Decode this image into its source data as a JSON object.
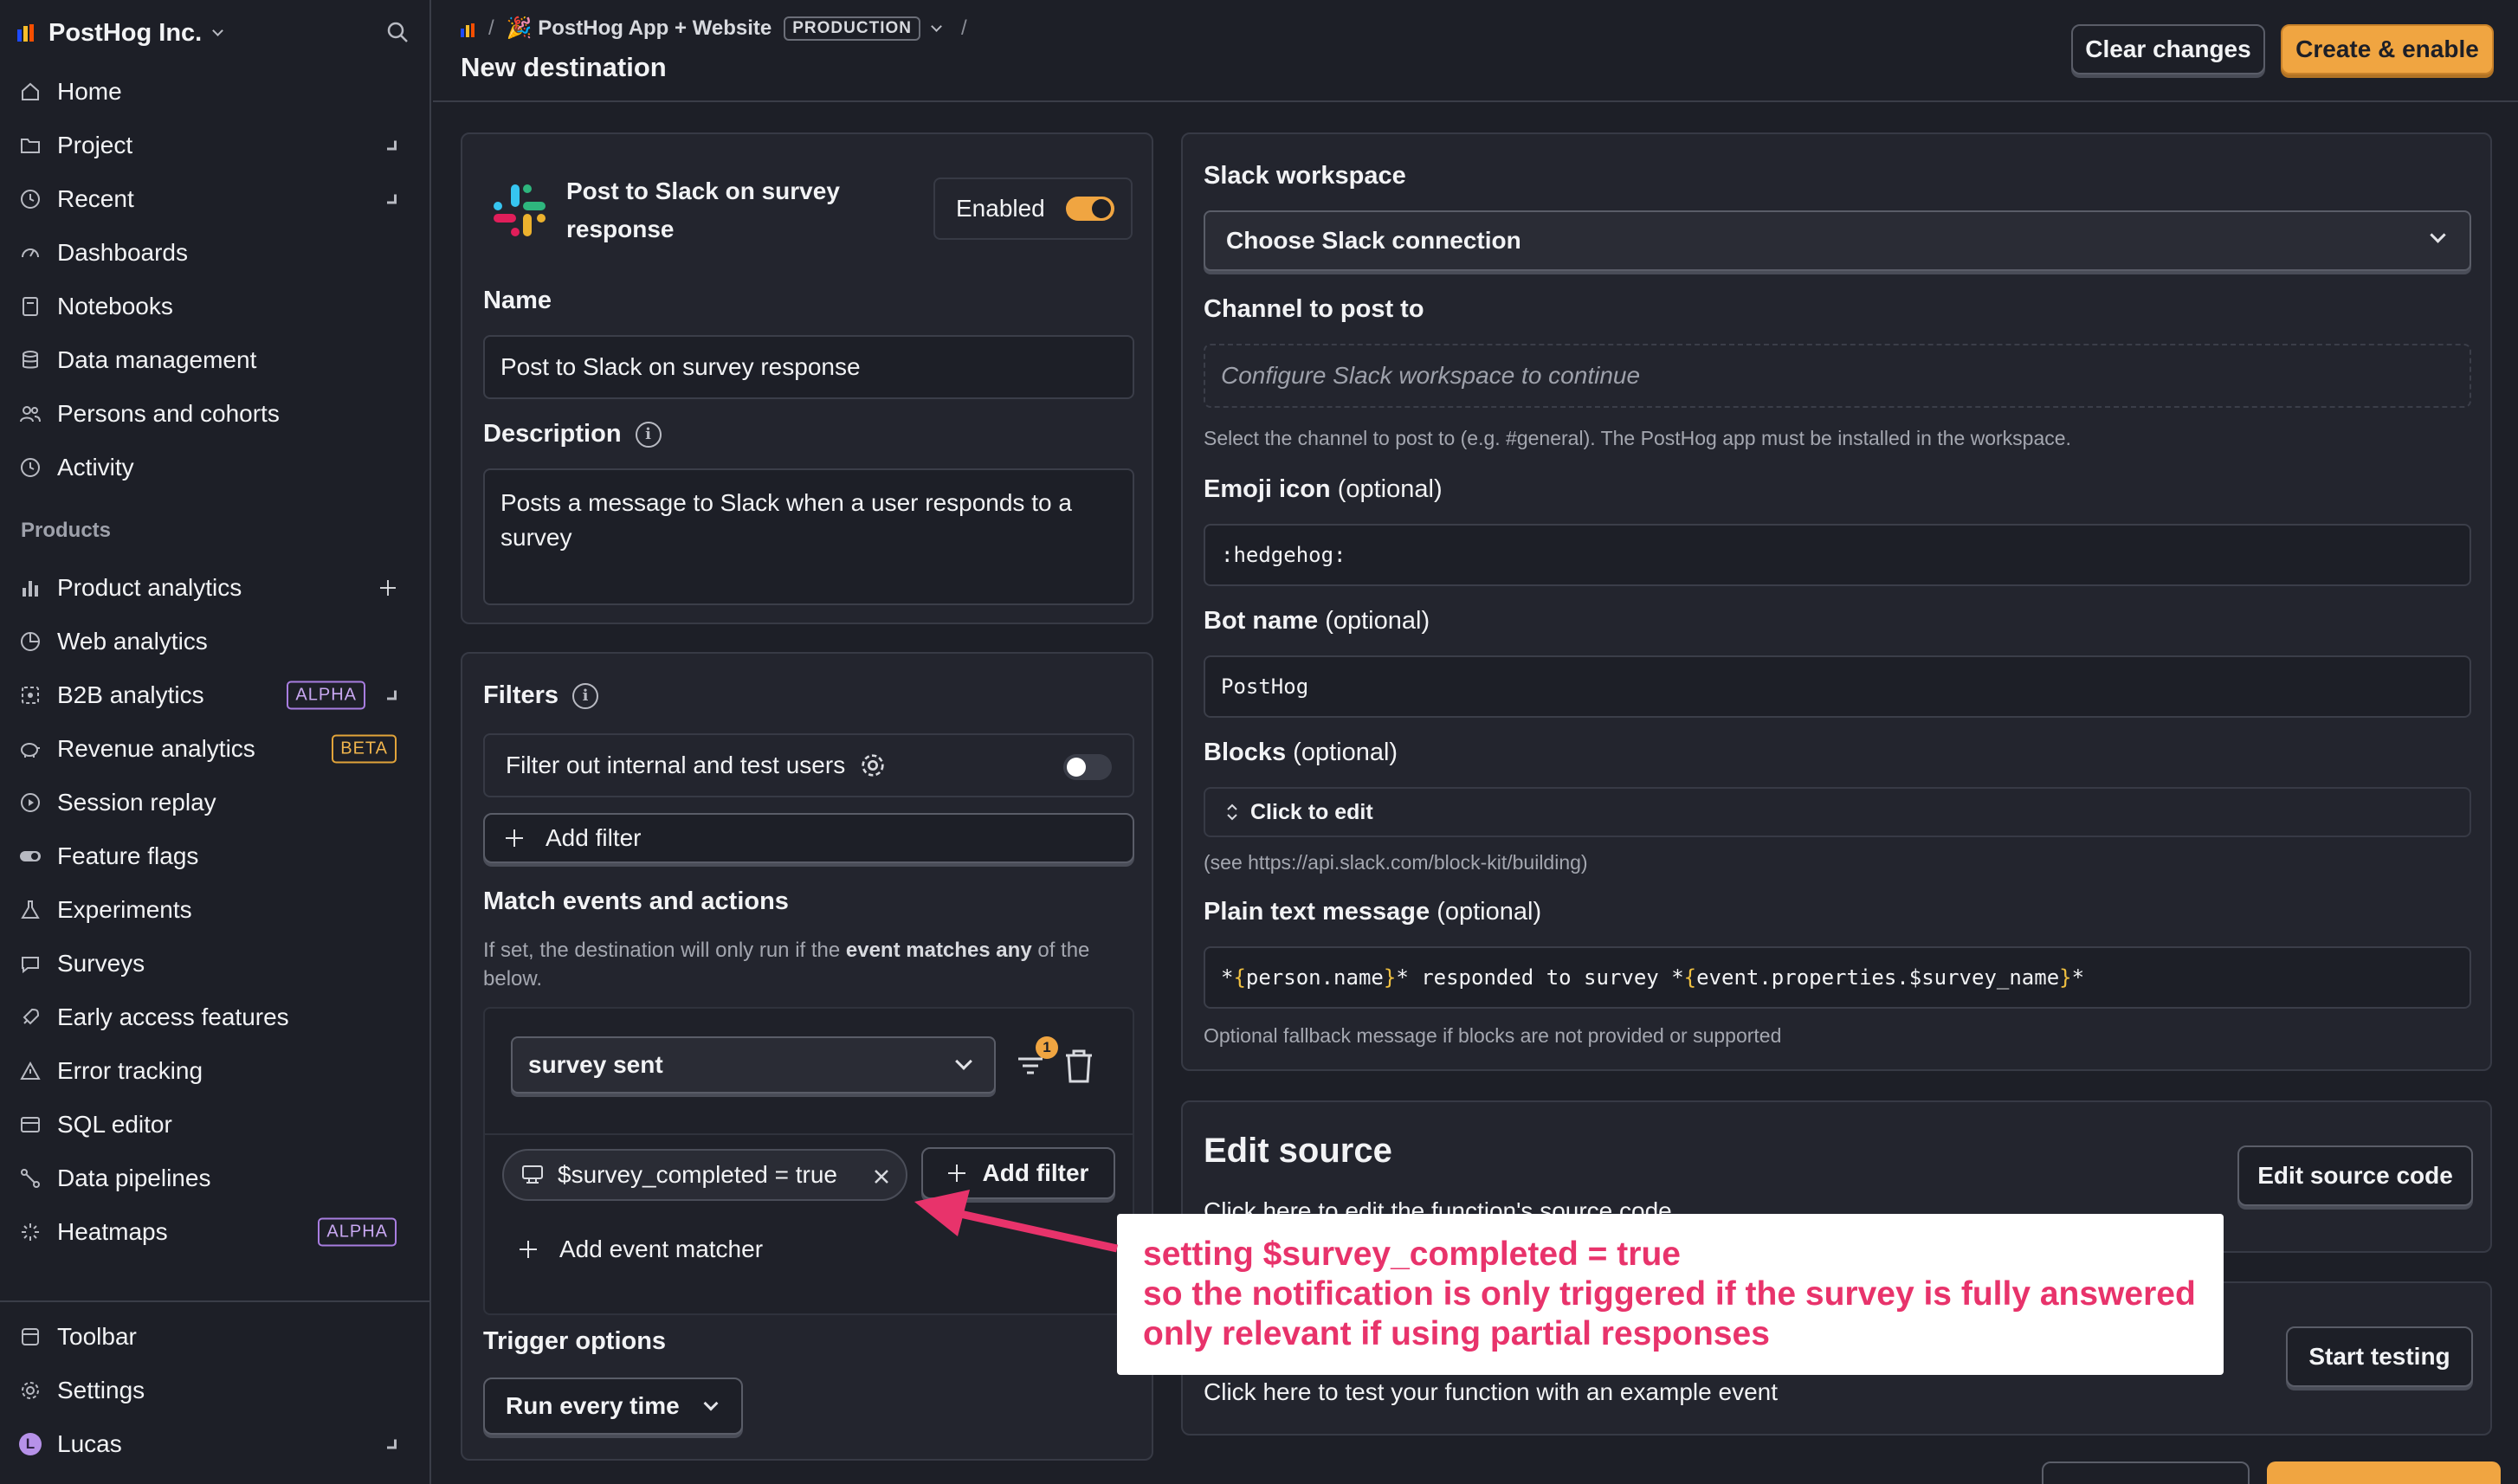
{
  "sidebar": {
    "org_name": "PostHog Inc.",
    "nav_top": [
      {
        "label": "Home",
        "icon": "home-icon"
      },
      {
        "label": "Project",
        "icon": "folder-icon"
      },
      {
        "label": "Recent",
        "icon": "clock-icon"
      },
      {
        "label": "Dashboards",
        "icon": "dashboard-icon"
      },
      {
        "label": "Notebooks",
        "icon": "notebook-icon"
      },
      {
        "label": "Data management",
        "icon": "database-icon"
      },
      {
        "label": "Persons and cohorts",
        "icon": "persons-icon"
      },
      {
        "label": "Activity",
        "icon": "activity-icon"
      }
    ],
    "products_label": "Products",
    "products": [
      {
        "label": "Product analytics",
        "icon": "bar-chart-icon"
      },
      {
        "label": "Web analytics",
        "icon": "pie-chart-icon"
      },
      {
        "label": "B2B analytics",
        "icon": "b2b-icon",
        "badge": "ALPHA"
      },
      {
        "label": "Revenue analytics",
        "icon": "piggy-bank-icon",
        "badge": "BETA"
      },
      {
        "label": "Session replay",
        "icon": "replay-icon"
      },
      {
        "label": "Feature flags",
        "icon": "toggle-icon"
      },
      {
        "label": "Experiments",
        "icon": "flask-icon"
      },
      {
        "label": "Surveys",
        "icon": "chat-bubble-icon"
      },
      {
        "label": "Early access features",
        "icon": "rocket-icon"
      },
      {
        "label": "Error tracking",
        "icon": "warning-icon"
      },
      {
        "label": "SQL editor",
        "icon": "sql-icon"
      },
      {
        "label": "Data pipelines",
        "icon": "pipeline-icon"
      },
      {
        "label": "Heatmaps",
        "icon": "heatmap-icon",
        "badge": "ALPHA"
      }
    ],
    "bottom": [
      {
        "label": "Toolbar",
        "icon": "toolbar-icon"
      },
      {
        "label": "Settings",
        "icon": "gear-icon"
      },
      {
        "label": "Lucas",
        "icon": "avatar",
        "avatar_letter": "L"
      }
    ]
  },
  "header": {
    "breadcrumb_project": "🎉 PostHog App + Website",
    "breadcrumb_env": "PRODUCTION",
    "title": "New destination",
    "clear_label": "Clear changes",
    "create_label": "Create & enable"
  },
  "destination": {
    "title": "Post to Slack on survey response",
    "enabled_label": "Enabled",
    "enabled": true,
    "name_label": "Name",
    "name_value": "Post to Slack on survey response",
    "description_label": "Description",
    "description_value": "Posts a message to Slack when a user responds to a survey"
  },
  "filters": {
    "title": "Filters",
    "internal_label": "Filter out internal and test users",
    "internal_enabled": false,
    "add_filter_label": "Add filter",
    "match_title": "Match events and actions",
    "match_help_1": "If set, the destination will only run if the ",
    "match_help_bold": "event matches any",
    "match_help_2": " of the below.",
    "event_select": "survey sent",
    "filter_count": "1",
    "property_filter": "$survey_completed = true",
    "add_property_filter_label": "Add filter",
    "add_matcher_label": "Add event matcher",
    "trigger_title": "Trigger options",
    "trigger_select": "Run every time"
  },
  "slack": {
    "workspace_label": "Slack workspace",
    "workspace_select": "Choose Slack connection",
    "channel_label": "Channel to post to",
    "channel_placeholder": "Configure Slack workspace to continue",
    "channel_help": "Select the channel to post to (e.g. #general). The PostHog app must be installed in the workspace.",
    "emoji_label": "Emoji icon",
    "optional": "(optional)",
    "emoji_value": ":hedgehog:",
    "bot_label": "Bot name",
    "bot_value": "PostHog",
    "blocks_label": "Blocks",
    "blocks_value": "Click to edit",
    "blocks_help": "(see https://api.slack.com/block-kit/building)",
    "message_label": "Plain text message",
    "message_p1": "*",
    "message_p2": "person.name",
    "message_p3": "* responded to survey *",
    "message_p4": "event.properties.$survey_name",
    "message_p5": "*",
    "message_help": "Optional fallback message if blocks are not provided or supported"
  },
  "source": {
    "title": "Edit source",
    "help": "Click here to edit the function's source code",
    "button": "Edit source code"
  },
  "testing": {
    "help": "Click here to test your function with an example event",
    "button": "Start testing"
  },
  "annotation": {
    "line1": "setting $survey_completed = true",
    "line2": "so the notification is only triggered if the survey is fully answered",
    "line3": "only relevant if using partial responses"
  },
  "colors": {
    "accent": "#f0a541",
    "annotation": "#e8336b",
    "background": "#1d1f27"
  }
}
